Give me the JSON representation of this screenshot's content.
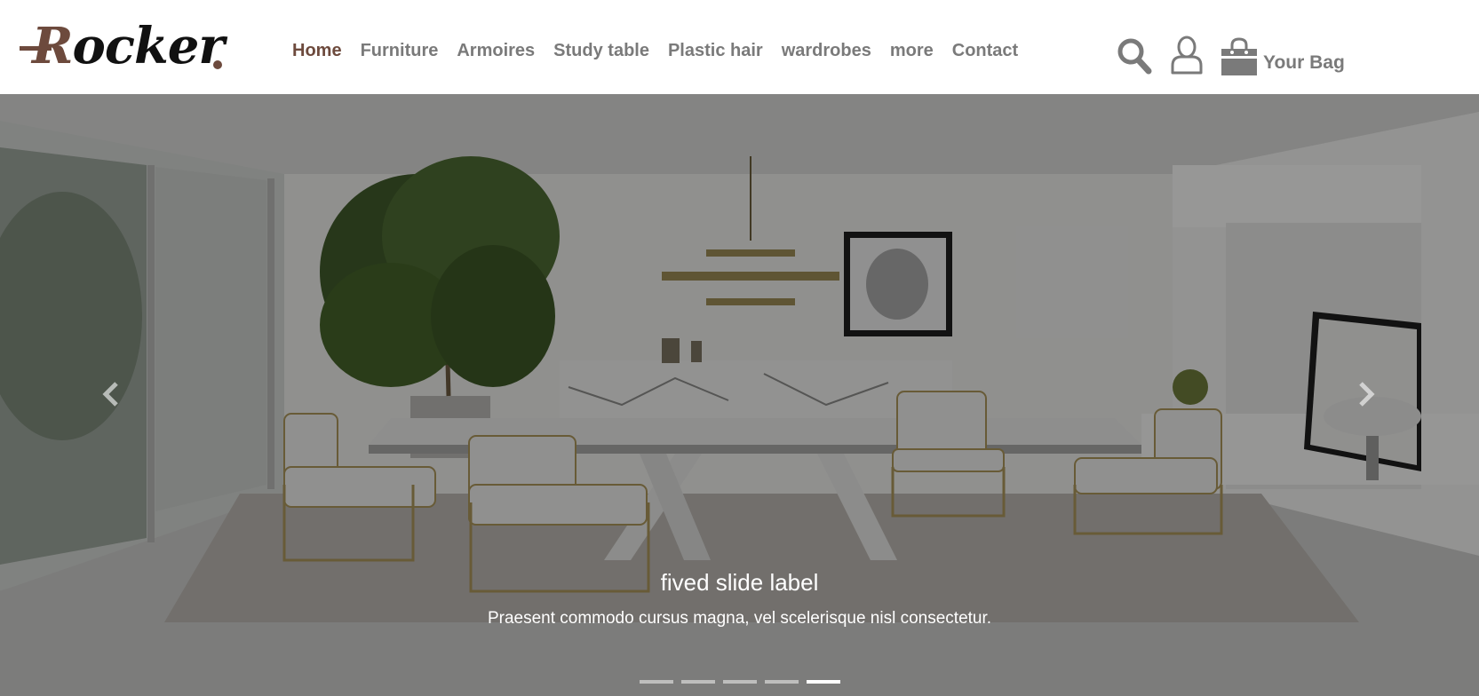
{
  "brand": {
    "logo_text": "Rocker",
    "logo_first_letter": "R",
    "logo_rest": "ocker",
    "accent_color": "#6d4a3d"
  },
  "nav": {
    "items": [
      {
        "label": "Home",
        "active": true
      },
      {
        "label": "Furniture",
        "active": false
      },
      {
        "label": "Armoires",
        "active": false
      },
      {
        "label": "Study table",
        "active": false
      },
      {
        "label": "Plastic hair",
        "active": false
      },
      {
        "label": "wardrobes",
        "active": false
      },
      {
        "label": "more",
        "active": false
      },
      {
        "label": "Contact",
        "active": false
      }
    ]
  },
  "actions": {
    "search_icon": "search-icon",
    "account_icon": "user-icon",
    "bag_icon": "shopping-bag-icon",
    "bag_label": "Your Bag"
  },
  "carousel": {
    "caption_title": "fived slide label",
    "caption_text": "Praesent commodo cursus magna, vel scelerisque nisl consectetur.",
    "slide_count": 5,
    "active_index": 4,
    "prev_icon": "chevron-left-icon",
    "next_icon": "chevron-right-icon"
  }
}
